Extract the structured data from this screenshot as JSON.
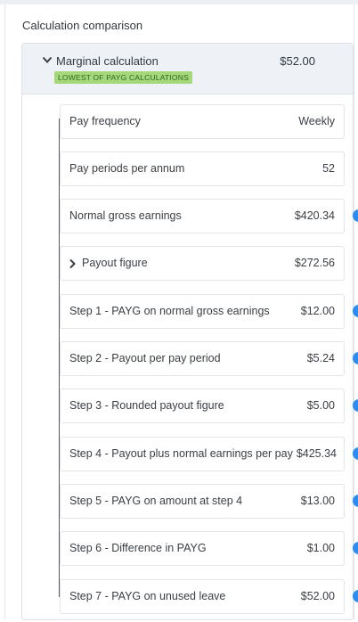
{
  "section_title": "Calculation comparison",
  "header": {
    "label": "Marginal calculation",
    "amount": "$52.00",
    "badge": "LOWEST OF PAYG CALCULATIONS",
    "expander_icon": "chevron-down-icon"
  },
  "rows": [
    {
      "label": "Pay frequency",
      "value": "Weekly",
      "info": false
    },
    {
      "label": "Pay periods per annum",
      "value": "52",
      "info": false
    },
    {
      "label": "Normal gross earnings",
      "value": "$420.34",
      "info": true
    },
    {
      "label": "Payout figure",
      "value": "$272.56",
      "info": false,
      "expandable": true
    },
    {
      "label": "Step 1 - PAYG on normal gross earnings",
      "value": "$12.00",
      "info": true
    },
    {
      "label": "Step 2 - Payout per pay period",
      "value": "$5.24",
      "info": true
    },
    {
      "label": "Step 3 - Rounded payout figure",
      "value": "$5.00",
      "info": true
    },
    {
      "label": "Step 4 - Payout plus normal earnings per pay",
      "value": "$425.34",
      "info": true
    },
    {
      "label": "Step 5 - PAYG on amount at step 4",
      "value": "$13.00",
      "info": true
    },
    {
      "label": "Step 6 - Difference in PAYG",
      "value": "$1.00",
      "info": true
    },
    {
      "label": "Step 7 - PAYG on unused leave",
      "value": "$52.00",
      "info": true
    }
  ],
  "colors": {
    "badge_bg": "#a6d77a",
    "badge_text": "#2e6a1e",
    "info_icon": "#2d8cf0",
    "header_bg": "#eef1f5"
  }
}
